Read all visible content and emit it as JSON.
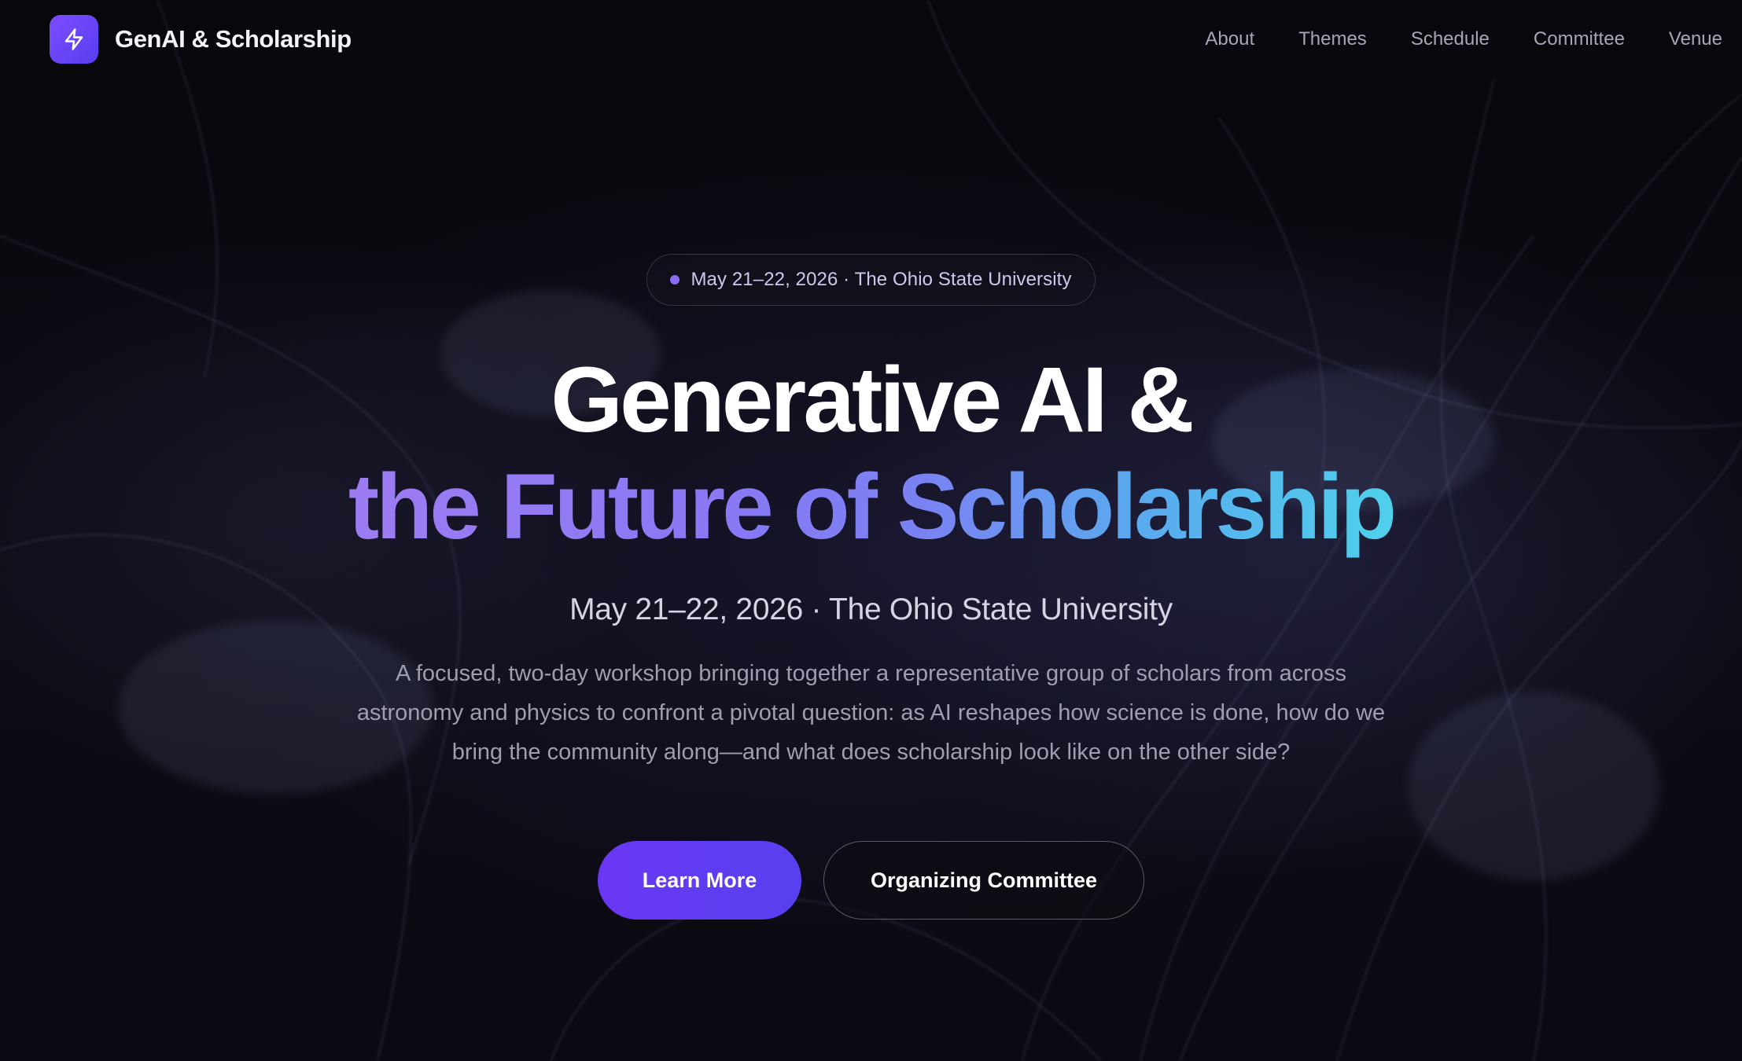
{
  "nav": {
    "brand": "GenAI & Scholarship",
    "logo_icon": "lightning-bolt-icon",
    "links": [
      "About",
      "Themes",
      "Schedule",
      "Committee",
      "Venue"
    ]
  },
  "hero": {
    "badge": "May 21–22, 2026 · The Ohio State University",
    "title_line1": "Generative AI &",
    "title_line2": "the Future of Scholarship",
    "subtitle": "May 21–22, 2026 · The Ohio State University",
    "description": "A focused, two-day workshop bringing together a representative group of scholars from across astronomy and physics to confront a pivotal question: as AI reshapes how science is done, how do we bring the community along—and what does scholarship look like on the other side?",
    "primary_button": "Learn More",
    "secondary_button": "Organizing Committee"
  },
  "colors": {
    "accent": "#6a37f5",
    "gradient_start": "#9d7cf2",
    "gradient_end": "#4fd0ec",
    "background": "#0b0a10"
  }
}
